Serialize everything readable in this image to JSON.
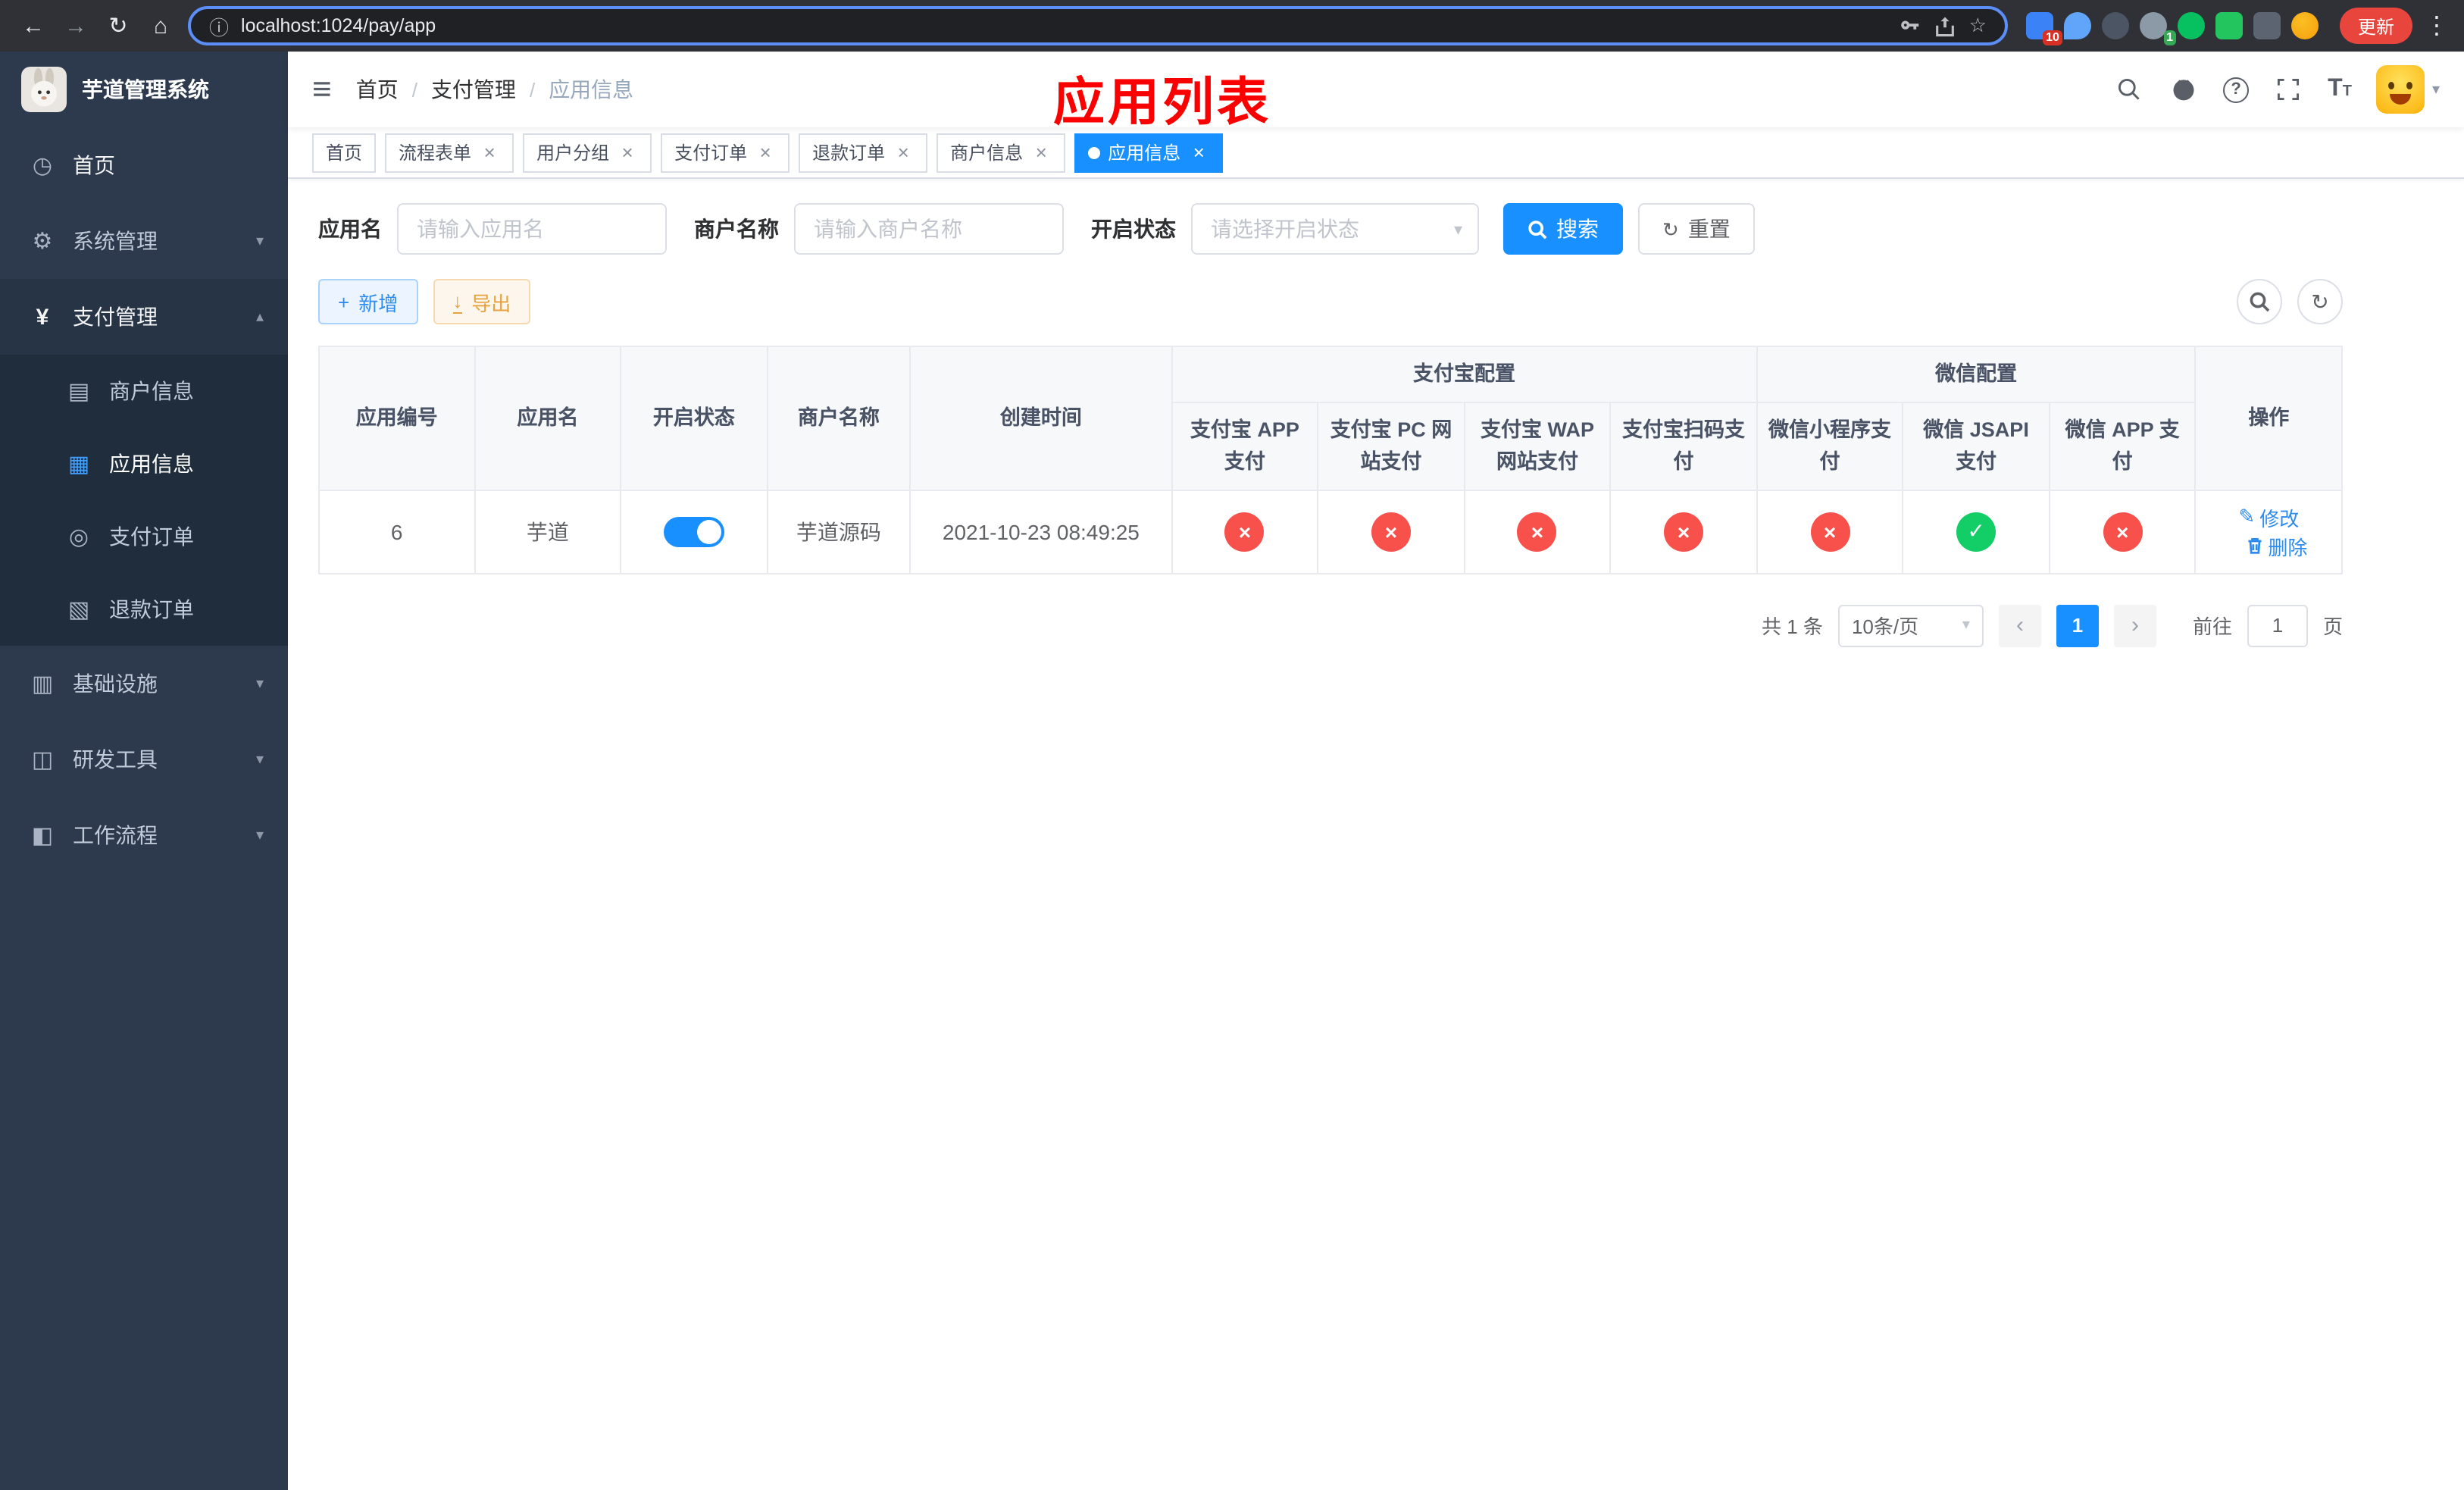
{
  "browser": {
    "url": "localhost:1024/pay/app",
    "update_label": "更新",
    "badge_blocker": "10",
    "badge_green": "1"
  },
  "icons": {
    "back": "←",
    "forward": "→",
    "reload": "↻",
    "home": "⌂",
    "info": "ⓘ",
    "star": "☆",
    "kebab": "⋮",
    "hamburger": "≡",
    "chevron_down": "▾",
    "chevron_up": "▴",
    "caret_down": "▾",
    "close": "×",
    "plus": "+",
    "download": "↓",
    "refresh": "↻",
    "edit": "✎",
    "prev": "‹",
    "next": "›",
    "question": "?",
    "dashboard": "◷",
    "gear": "⚙",
    "yen": "¥",
    "merchant": "▤",
    "app": "▦",
    "order": "◎",
    "refund": "▧",
    "infra": "▥",
    "tool": "◫",
    "flow": "◧",
    "check": "✓",
    "cross": "×",
    "font_size_big": "T",
    "font_size_small": "T"
  },
  "sidebar": {
    "title": "芋道管理系统",
    "home": "首页",
    "system": "系统管理",
    "payment": "支付管理",
    "merchant_info": "商户信息",
    "app_info": "应用信息",
    "pay_order": "支付订单",
    "refund_order": "退款订单",
    "infra": "基础设施",
    "devtools": "研发工具",
    "workflow": "工作流程"
  },
  "navbar": {
    "breadcrumb": {
      "home": "首页",
      "payment": "支付管理",
      "current": "应用信息",
      "separator": "/"
    },
    "annotation": "应用列表"
  },
  "tabs": [
    {
      "label": "首页"
    },
    {
      "label": "流程表单"
    },
    {
      "label": "用户分组"
    },
    {
      "label": "支付订单"
    },
    {
      "label": "退款订单"
    },
    {
      "label": "商户信息"
    },
    {
      "label": "应用信息"
    }
  ],
  "filters": {
    "app_name_label": "应用名",
    "app_name_placeholder": "请输入应用名",
    "merchant_label": "商户名称",
    "merchant_placeholder": "请输入商户名称",
    "status_label": "开启状态",
    "status_placeholder": "请选择开启状态",
    "search_label": "搜索",
    "reset_label": "重置"
  },
  "toolbar": {
    "add_label": "新增",
    "export_label": "导出"
  },
  "table": {
    "columns": {
      "app_id": "应用编号",
      "app_name": "应用名",
      "status": "开启状态",
      "merchant": "商户名称",
      "created": "创建时间",
      "alipay_group": "支付宝配置",
      "wechat_group": "微信配置",
      "alipay_app": "支付宝 APP 支付",
      "alipay_pc": "支付宝 PC 网站支付",
      "alipay_wap": "支付宝 WAP 网站支付",
      "alipay_qr": "支付宝扫码支付",
      "wx_mini": "微信小程序支付",
      "wx_jsapi": "微信 JSAPI 支付",
      "wx_app": "微信 APP 支付",
      "actions": "操作"
    },
    "row": {
      "app_id": "6",
      "app_name": "芋道",
      "status_on": true,
      "merchant": "芋道源码",
      "created": "2021-10-23 08:49:25",
      "alipay_app": false,
      "alipay_pc": false,
      "alipay_wap": false,
      "alipay_qr": false,
      "wx_mini": false,
      "wx_jsapi": true,
      "wx_app": false,
      "edit_label": "修改",
      "delete_label": "删除"
    }
  },
  "pagination": {
    "total": "共 1 条",
    "page_size": "10条/页",
    "current": "1",
    "goto_label": "前往",
    "goto_value": "1",
    "unit": "页"
  }
}
